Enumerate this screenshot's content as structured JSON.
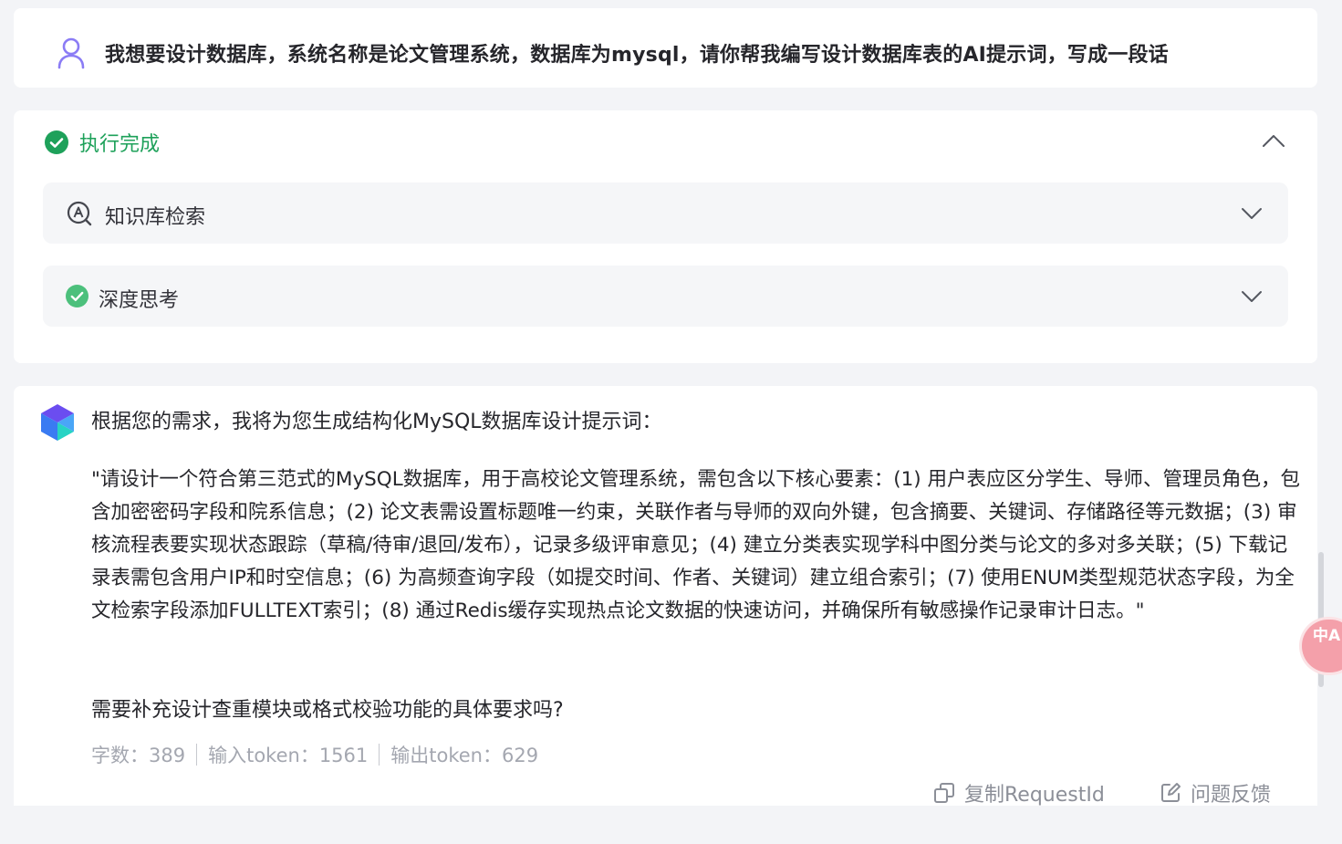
{
  "user_message": {
    "text": "我想要设计数据库，系统名称是论文管理系统，数据库为mysql，请你帮我编写设计数据库表的AI提示词，写成一段话",
    "icon": "user-icon"
  },
  "execution": {
    "status_label": "执行完成",
    "status_color": "#1ea15a",
    "collapse_icon": "chevron-up-icon",
    "steps": [
      {
        "label": "知识库检索",
        "icon": "knowledge-search-icon",
        "expand_icon": "chevron-down-icon"
      },
      {
        "label": "深度思考",
        "icon": "check-circle-icon",
        "expand_icon": "chevron-down-icon"
      }
    ]
  },
  "answer": {
    "intro": "根据您的需求，我将为您生成结构化MySQL数据库设计提示词：",
    "quote": "\"请设计一个符合第三范式的MySQL数据库，用于高校论文管理系统，需包含以下核心要素：(1) 用户表应区分学生、导师、管理员角色，包含加密密码字段和院系信息；(2) 论文表需设置标题唯一约束，关联作者与导师的双向外键，包含摘要、关键词、存储路径等元数据；(3) 审核流程表要实现状态跟踪（草稿/待审/退回/发布），记录多级评审意见；(4) 建立分类表实现学科中图分类与论文的多对多关联；(5) 下载记录表需包含用户IP和时空信息；(6) 为高频查询字段（如提交时间、作者、关键词）建立组合索引；(7) 使用ENUM类型规范状态字段，为全文检索字段添加FULLTEXT索引；(8) 通过Redis缓存实现热点论文数据的快速访问，并确保所有敏感操作记录审计日志。\"",
    "question": "需要补充设计查重模块或格式校验功能的具体要求吗?",
    "stats": {
      "chars": "字数：389",
      "input_tokens": "输入token：1561",
      "output_tokens": "输出token：629"
    },
    "actions": {
      "copy": "复制RequestId",
      "feedback": "问题反馈"
    }
  },
  "widgets": {
    "translate_label": "中A"
  }
}
